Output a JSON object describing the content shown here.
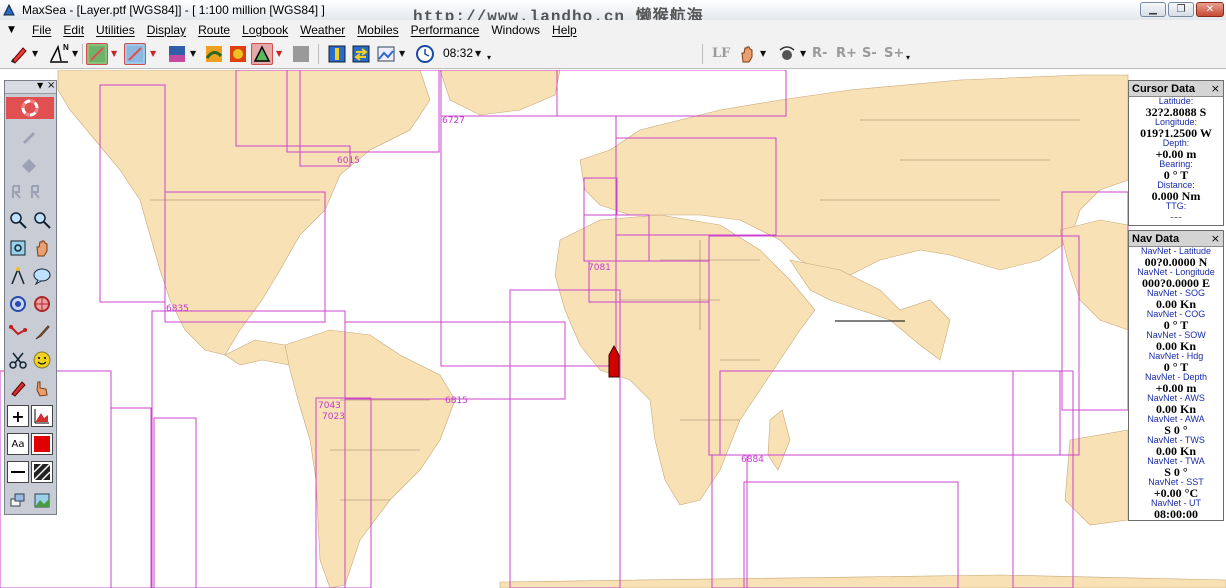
{
  "window": {
    "title": "MaxSea - [Layer.ptf [WGS84]] - [ 1:100 million [WGS84] ]",
    "watermark": "http://www.landho.cn 懒猴航海",
    "min_glyph": "▁",
    "max_glyph": "❐",
    "close_glyph": "✕"
  },
  "menu": {
    "drop_glyph": "▼",
    "items": [
      "File",
      "Edit",
      "Utilities",
      "Display",
      "Route",
      "Logbook",
      "Weather",
      "Mobiles",
      "Performance",
      "Windows",
      "Help"
    ]
  },
  "toolbar": {
    "time": "08:32",
    "lf_label": "LF",
    "r_minus": "R-",
    "r_plus": "R+",
    "s_minus": "S-",
    "s_plus": "S+",
    "north_glyph": "N"
  },
  "map": {
    "chart_labels": [
      "6727",
      "6015",
      "7081",
      "6835",
      "6815",
      "7043",
      "7023",
      "6884"
    ],
    "colors": {
      "land": "#f7e1b5",
      "sea": "#ffffff",
      "chart_border": "#cc44cc",
      "vessel": "#d40000"
    }
  },
  "palette": {
    "arrow_glyph": "▼",
    "close_glyph": "×",
    "text_tool": "Aa",
    "plus_tool": "+"
  },
  "cursor_data": {
    "title": "Cursor Data",
    "close_glyph": "×",
    "fields": [
      {
        "label": "Latitude:",
        "value": "32?2.8088 S"
      },
      {
        "label": "Longitude:",
        "value": "019?1.2500 W"
      },
      {
        "label": "Depth:",
        "value": "+0.00 m"
      },
      {
        "label": "Bearing:",
        "value": "0 ° T"
      },
      {
        "label": "Distance:",
        "value": "0.000 Nm"
      },
      {
        "label": "TTG:",
        "value": "---"
      }
    ]
  },
  "nav_data": {
    "title": "Nav Data",
    "close_glyph": "×",
    "fields": [
      {
        "label": "NavNet - Latitude",
        "value": "00?0.0000 N"
      },
      {
        "label": "NavNet - Longitude",
        "value": "000?0.0000 E"
      },
      {
        "label": "NavNet - SOG",
        "value": "0.00 Kn"
      },
      {
        "label": "NavNet - COG",
        "value": "0 ° T"
      },
      {
        "label": "NavNet - SOW",
        "value": "0.00 Kn"
      },
      {
        "label": "NavNet - Hdg",
        "value": "0 ° T"
      },
      {
        "label": "NavNet - Depth",
        "value": "+0.00 m"
      },
      {
        "label": "NavNet - AWS",
        "value": "0.00 Kn"
      },
      {
        "label": "NavNet - AWA",
        "value": "S 0 °"
      },
      {
        "label": "NavNet - TWS",
        "value": "0.00 Kn"
      },
      {
        "label": "NavNet - TWA",
        "value": "S 0 °"
      },
      {
        "label": "NavNet - SST",
        "value": "+0.00 °C"
      },
      {
        "label": "NavNet - UT",
        "value": "08:00:00"
      }
    ]
  }
}
